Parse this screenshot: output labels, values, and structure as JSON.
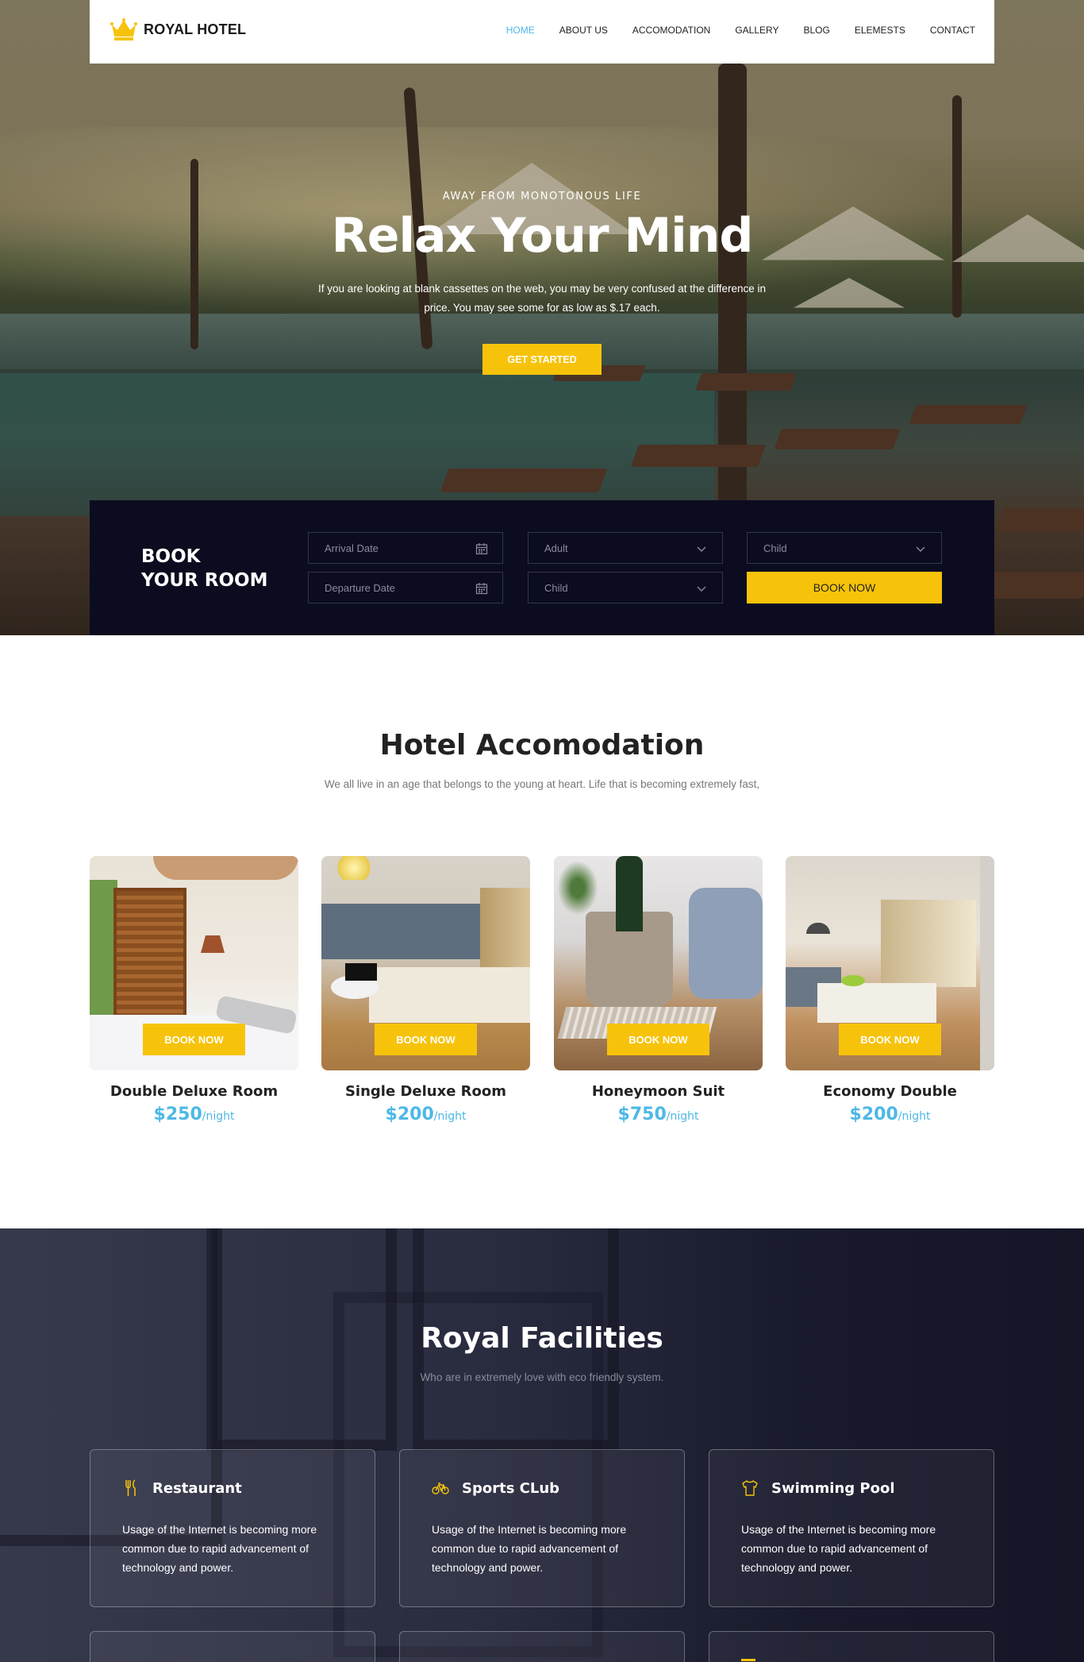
{
  "brand": {
    "name": "ROYAL HOTEL",
    "accent": "#f7c30a",
    "link_active": "#4eb8e6",
    "dark": "#0b0c1f"
  },
  "nav": {
    "items": [
      {
        "label": "HOME",
        "active": true
      },
      {
        "label": "ABOUT US"
      },
      {
        "label": "ACCOMODATION"
      },
      {
        "label": "GALLERY"
      },
      {
        "label": "BLOG"
      },
      {
        "label": "ELEMESTS"
      },
      {
        "label": "CONTACT"
      }
    ]
  },
  "hero": {
    "kicker": "AWAY FROM MONOTONOUS LIFE",
    "title": "Relax Your Mind",
    "description": "If you are looking at blank cassettes on the web, you may be very confused at the difference in price. You may see some for as low as $.17 each.",
    "cta": "GET STARTED"
  },
  "booking": {
    "title": "BOOK\nYOUR ROOM",
    "arrival_placeholder": "Arrival Date",
    "departure_placeholder": "Departure Date",
    "adult_select": "Adult",
    "child_select_1": "Child",
    "child_select_2": "Child",
    "submit": "BOOK NOW"
  },
  "accommodation": {
    "title": "Hotel Accomodation",
    "subtitle": "We all live in an age that belongs to the young at heart. Life that is becoming extremely fast,",
    "rooms": [
      {
        "name": "Double Deluxe Room",
        "price": "$250",
        "per": "/night",
        "button": "BOOK NOW"
      },
      {
        "name": "Single Deluxe Room",
        "price": "$200",
        "per": "/night",
        "button": "BOOK NOW"
      },
      {
        "name": "Honeymoon Suit",
        "price": "$750",
        "per": "/night",
        "button": "BOOK NOW"
      },
      {
        "name": "Economy Double",
        "price": "$200",
        "per": "/night",
        "button": "BOOK NOW"
      }
    ]
  },
  "facilities": {
    "title": "Royal Facilities",
    "subtitle": "Who are in extremely love with eco friendly system.",
    "items": [
      {
        "name": "Restaurant",
        "icon": "cutlery-icon",
        "text": "Usage of the Internet is becoming more common due to rapid advancement of technology and power."
      },
      {
        "name": "Sports CLub",
        "icon": "bicycle-icon",
        "text": "Usage of the Internet is becoming more common due to rapid advancement of technology and power."
      },
      {
        "name": "Swimming Pool",
        "icon": "shirt-icon",
        "text": "Usage of the Internet is becoming more common due to rapid advancement of technology and power."
      }
    ]
  }
}
